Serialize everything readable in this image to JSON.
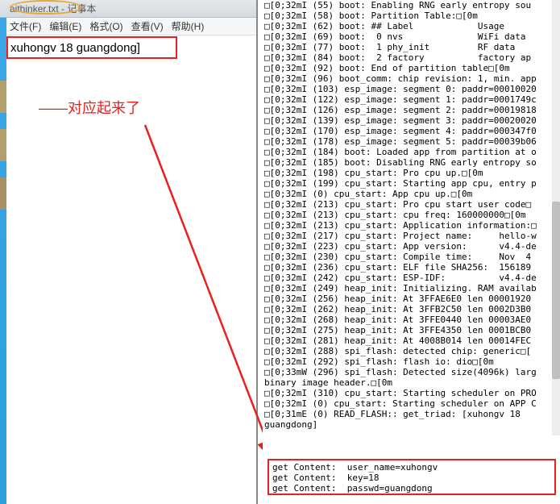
{
  "notepad": {
    "title": "aithinker.txt - 记事本",
    "menus": {
      "file": "文件(F)",
      "edit": "编辑(E)",
      "format": "格式(O)",
      "view": "查看(V)",
      "help": "帮助(H)"
    },
    "content": "xuhongv 18 guangdong]"
  },
  "annotation": "——对应起来了",
  "console_lines": [
    "□[0;32mI (55) boot: Enabling RNG early entropy sou",
    "□[0;32mI (58) boot: Partition Table:□[0m",
    "□[0;32mI (62) boot: ## Label            Usage",
    "□[0;32mI (69) boot:  0 nvs              WiFi data",
    "□[0;32mI (77) boot:  1 phy_init         RF data",
    "□[0;32mI (84) boot:  2 factory          factory ap",
    "□[0;32mI (92) boot: End of partition table□[0m",
    "□[0;32mI (96) boot_comm: chip revision: 1, min. app",
    "□[0;32mI (103) esp_image: segment 0: paddr=00010020",
    "□[0;32mI (122) esp_image: segment 1: paddr=0001749c",
    "□[0;32mI (126) esp_image: segment 2: paddr=00019818",
    "□[0;32mI (139) esp_image: segment 3: paddr=00020020",
    "□[0;32mI (170) esp_image: segment 4: paddr=000347f0",
    "□[0;32mI (178) esp_image: segment 5: paddr=00039b06",
    "□[0;32mI (184) boot: Loaded app from partition at o",
    "□[0;32mI (185) boot: Disabling RNG early entropy so",
    "□[0;32mI (198) cpu_start: Pro cpu up.□[0m",
    "□[0;32mI (199) cpu_start: Starting app cpu, entry p",
    "□[0;32mI (0) cpu_start: App cpu up.□[0m",
    "□[0;32mI (213) cpu_start: Pro cpu start user code□",
    "□[0;32mI (213) cpu_start: cpu freq: 160000000□[0m",
    "□[0;32mI (213) cpu_start: Application information:□",
    "□[0;32mI (217) cpu_start: Project name:     hello-w",
    "□[0;32mI (223) cpu_start: App version:      v4.4-de",
    "□[0;32mI (230) cpu_start: Compile time:     Nov  4",
    "□[0;32mI (236) cpu_start: ELF file SHA256:  156189",
    "□[0;32mI (242) cpu_start: ESP-IDF:          v4.4-de",
    "□[0;32mI (249) heap_init: Initializing. RAM availab",
    "□[0;32mI (256) heap_init: At 3FFAE6E0 len 00001920",
    "□[0;32mI (262) heap_init: At 3FFB2C50 len 0002D3B0",
    "□[0;32mI (268) heap_init: At 3FFE0440 len 00003AE0",
    "□[0;32mI (275) heap_init: At 3FFE4350 len 0001BCB0",
    "□[0;32mI (281) heap_init: At 4008B014 len 00014FEC",
    "□[0;32mI (288) spi_flash: detected chip: generic□[",
    "□[0;32mI (292) spi_flash: flash io: dio□[0m",
    "□[0;33mW (296) spi_flash: Detected size(4096k) larg",
    "binary image header.□[0m",
    "□[0;32mI (310) cpu_start: Starting scheduler on PRO",
    "□[0;32mI (0) cpu_start: Starting scheduler on APP C",
    "□[0;31mE (0) READ_FLASH:: get_triad: [xuhongv 18",
    "guangdong]"
  ],
  "result_box": {
    "line1": "get Content:  user_name=xuhongv",
    "line2": "get Content:  key=18",
    "line3": "get Content:  passwd=guangdong"
  }
}
